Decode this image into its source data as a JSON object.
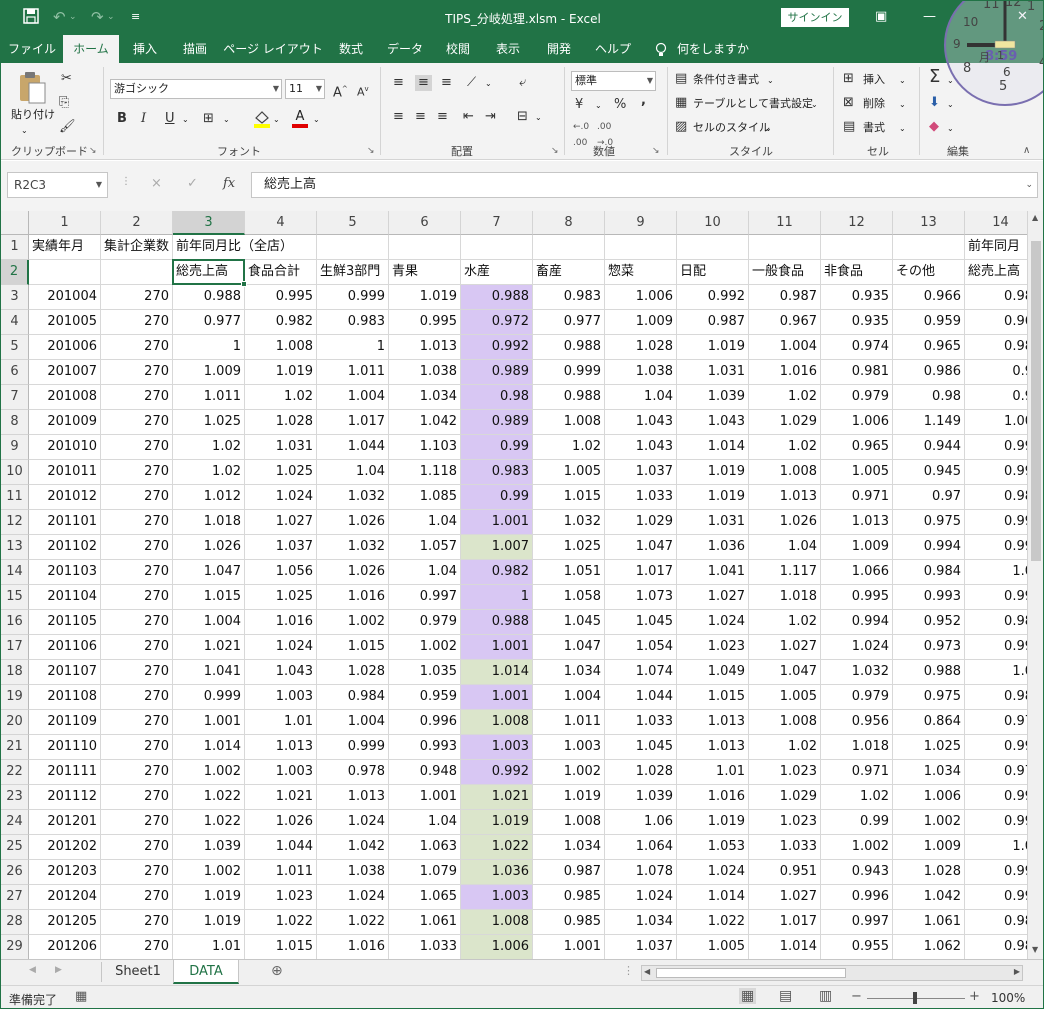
{
  "window": {
    "title": "TIPS_分岐処理.xlsm  -  Excel",
    "signin": "サインイン",
    "save_icon": "save-icon",
    "undo_icon": "undo-icon",
    "redo_icon": "redo-icon"
  },
  "tabs": [
    "ファイル",
    "ホーム",
    "挿入",
    "描画",
    "ページ レイアウト",
    "数式",
    "データ",
    "校閲",
    "表示",
    "開発",
    "ヘルプ",
    "何をしますか"
  ],
  "ribbon": {
    "clipboard": {
      "paste": "貼り付け",
      "label": "クリップボード"
    },
    "font": {
      "name": "游ゴシック",
      "size": "11",
      "label": "フォント",
      "bold": "B",
      "italic": "I",
      "underline": "U",
      "grow": "A",
      "shrink": "A",
      "fontcolor": "A"
    },
    "alignment": {
      "label": "配置"
    },
    "number": {
      "format": "標準",
      "label": "数値",
      "percent": "%",
      "comma": ","
    },
    "styles": {
      "conditional": "条件付き書式",
      "table": "テーブルとして書式設定",
      "cell": "セルのスタイル",
      "label": "スタイル"
    },
    "cells": {
      "insert": "挿入",
      "delete": "削除",
      "format": "書式",
      "label": "セル"
    },
    "editing": {
      "label": "編集",
      "sum": "Σ"
    }
  },
  "formula_bar": {
    "name_box": "R2C3",
    "cancel": "×",
    "enter": "✓",
    "fx": "fx",
    "content": "総売上高"
  },
  "columns": [
    "1",
    "2",
    "3",
    "4",
    "5",
    "6",
    "7",
    "8",
    "9",
    "10",
    "11",
    "12",
    "13",
    "14"
  ],
  "selected": {
    "row": 2,
    "col": 3
  },
  "rows": [
    {
      "n": "1",
      "cells": [
        "実績年月",
        "集計企業数",
        "前年同月比（全店）",
        "",
        "",
        "",
        "",
        "",
        "",
        "",
        "",
        "",
        "",
        "前年同月"
      ]
    },
    {
      "n": "2",
      "cells": [
        "",
        "",
        "総売上高",
        "食品合計",
        "生鮮3部門",
        "青果",
        "水産",
        "畜産",
        "惣菜",
        "日配",
        "一般食品",
        "非食品",
        "その他",
        "総売上高"
      ]
    },
    {
      "n": "3",
      "cells": [
        "201004",
        "270",
        "0.988",
        "0.995",
        "0.999",
        "1.019",
        "0.988",
        "0.983",
        "1.006",
        "0.992",
        "0.987",
        "0.935",
        "0.966",
        "0.98"
      ]
    },
    {
      "n": "4",
      "cells": [
        "201005",
        "270",
        "0.977",
        "0.982",
        "0.983",
        "0.995",
        "0.972",
        "0.977",
        "1.009",
        "0.987",
        "0.967",
        "0.935",
        "0.959",
        "0.96"
      ]
    },
    {
      "n": "5",
      "cells": [
        "201006",
        "270",
        "1",
        "1.008",
        "1",
        "1.013",
        "0.992",
        "0.988",
        "1.028",
        "1.019",
        "1.004",
        "0.974",
        "0.965",
        "0.98"
      ]
    },
    {
      "n": "6",
      "cells": [
        "201007",
        "270",
        "1.009",
        "1.019",
        "1.011",
        "1.038",
        "0.989",
        "0.999",
        "1.038",
        "1.031",
        "1.016",
        "0.981",
        "0.986",
        "0.9"
      ]
    },
    {
      "n": "7",
      "cells": [
        "201008",
        "270",
        "1.011",
        "1.02",
        "1.004",
        "1.034",
        "0.98",
        "0.988",
        "1.04",
        "1.039",
        "1.02",
        "0.979",
        "0.98",
        "0.9"
      ]
    },
    {
      "n": "8",
      "cells": [
        "201009",
        "270",
        "1.025",
        "1.028",
        "1.017",
        "1.042",
        "0.989",
        "1.008",
        "1.043",
        "1.043",
        "1.029",
        "1.006",
        "1.149",
        "1.00"
      ]
    },
    {
      "n": "9",
      "cells": [
        "201010",
        "270",
        "1.02",
        "1.031",
        "1.044",
        "1.103",
        "0.99",
        "1.02",
        "1.043",
        "1.014",
        "1.02",
        "0.965",
        "0.944",
        "0.99"
      ]
    },
    {
      "n": "10",
      "cells": [
        "201011",
        "270",
        "1.02",
        "1.025",
        "1.04",
        "1.118",
        "0.983",
        "1.005",
        "1.037",
        "1.019",
        "1.008",
        "1.005",
        "0.945",
        "0.99"
      ]
    },
    {
      "n": "11",
      "cells": [
        "201012",
        "270",
        "1.012",
        "1.024",
        "1.032",
        "1.085",
        "0.99",
        "1.015",
        "1.033",
        "1.019",
        "1.013",
        "0.971",
        "0.97",
        "0.98"
      ]
    },
    {
      "n": "12",
      "cells": [
        "201101",
        "270",
        "1.018",
        "1.027",
        "1.026",
        "1.04",
        "1.001",
        "1.032",
        "1.029",
        "1.031",
        "1.026",
        "1.013",
        "0.975",
        "0.99"
      ]
    },
    {
      "n": "13",
      "cells": [
        "201102",
        "270",
        "1.026",
        "1.037",
        "1.032",
        "1.057",
        "1.007",
        "1.025",
        "1.047",
        "1.036",
        "1.04",
        "1.009",
        "0.994",
        "0.99"
      ]
    },
    {
      "n": "14",
      "cells": [
        "201103",
        "270",
        "1.047",
        "1.056",
        "1.026",
        "1.04",
        "0.982",
        "1.051",
        "1.017",
        "1.041",
        "1.117",
        "1.066",
        "0.984",
        "1.0"
      ]
    },
    {
      "n": "15",
      "cells": [
        "201104",
        "270",
        "1.015",
        "1.025",
        "1.016",
        "0.997",
        "1",
        "1.058",
        "1.073",
        "1.027",
        "1.018",
        "0.995",
        "0.993",
        "0.99"
      ]
    },
    {
      "n": "16",
      "cells": [
        "201105",
        "270",
        "1.004",
        "1.016",
        "1.002",
        "0.979",
        "0.988",
        "1.045",
        "1.045",
        "1.024",
        "1.02",
        "0.994",
        "0.952",
        "0.98"
      ]
    },
    {
      "n": "17",
      "cells": [
        "201106",
        "270",
        "1.021",
        "1.024",
        "1.015",
        "1.002",
        "1.001",
        "1.047",
        "1.054",
        "1.023",
        "1.027",
        "1.024",
        "0.973",
        "0.99"
      ]
    },
    {
      "n": "18",
      "cells": [
        "201107",
        "270",
        "1.041",
        "1.043",
        "1.028",
        "1.035",
        "1.014",
        "1.034",
        "1.074",
        "1.049",
        "1.047",
        "1.032",
        "0.988",
        "1.0"
      ]
    },
    {
      "n": "19",
      "cells": [
        "201108",
        "270",
        "0.999",
        "1.003",
        "0.984",
        "0.959",
        "1.001",
        "1.004",
        "1.044",
        "1.015",
        "1.005",
        "0.979",
        "0.975",
        "0.98"
      ]
    },
    {
      "n": "20",
      "cells": [
        "201109",
        "270",
        "1.001",
        "1.01",
        "1.004",
        "0.996",
        "1.008",
        "1.011",
        "1.033",
        "1.013",
        "1.008",
        "0.956",
        "0.864",
        "0.97"
      ]
    },
    {
      "n": "21",
      "cells": [
        "201110",
        "270",
        "1.014",
        "1.013",
        "0.999",
        "0.993",
        "1.003",
        "1.003",
        "1.045",
        "1.013",
        "1.02",
        "1.018",
        "1.025",
        "0.99"
      ]
    },
    {
      "n": "22",
      "cells": [
        "201111",
        "270",
        "1.002",
        "1.003",
        "0.978",
        "0.948",
        "0.992",
        "1.002",
        "1.028",
        "1.01",
        "1.023",
        "0.971",
        "1.034",
        "0.97"
      ]
    },
    {
      "n": "23",
      "cells": [
        "201112",
        "270",
        "1.022",
        "1.021",
        "1.013",
        "1.001",
        "1.021",
        "1.019",
        "1.039",
        "1.016",
        "1.029",
        "1.02",
        "1.006",
        "0.99"
      ]
    },
    {
      "n": "24",
      "cells": [
        "201201",
        "270",
        "1.022",
        "1.026",
        "1.024",
        "1.04",
        "1.019",
        "1.008",
        "1.06",
        "1.019",
        "1.023",
        "0.99",
        "1.002",
        "0.99"
      ]
    },
    {
      "n": "25",
      "cells": [
        "201202",
        "270",
        "1.039",
        "1.044",
        "1.042",
        "1.063",
        "1.022",
        "1.034",
        "1.064",
        "1.053",
        "1.033",
        "1.002",
        "1.009",
        "1.0"
      ]
    },
    {
      "n": "26",
      "cells": [
        "201203",
        "270",
        "1.002",
        "1.011",
        "1.038",
        "1.079",
        "1.036",
        "0.987",
        "1.078",
        "1.024",
        "0.951",
        "0.943",
        "1.028",
        "0.99"
      ]
    },
    {
      "n": "27",
      "cells": [
        "201204",
        "270",
        "1.019",
        "1.023",
        "1.024",
        "1.065",
        "1.003",
        "0.985",
        "1.024",
        "1.014",
        "1.027",
        "0.996",
        "1.042",
        "0.99"
      ]
    },
    {
      "n": "28",
      "cells": [
        "201205",
        "270",
        "1.019",
        "1.022",
        "1.022",
        "1.061",
        "1.008",
        "0.985",
        "1.034",
        "1.022",
        "1.017",
        "0.997",
        "1.061",
        "0.98"
      ]
    },
    {
      "n": "29",
      "cells": [
        "201206",
        "270",
        "1.01",
        "1.015",
        "1.016",
        "1.033",
        "1.006",
        "1.001",
        "1.037",
        "1.005",
        "1.014",
        "0.955",
        "1.062",
        "0.98"
      ]
    }
  ],
  "col7_fill": [
    "",
    "",
    "purple",
    "purple",
    "purple",
    "purple",
    "purple",
    "purple",
    "purple",
    "purple",
    "purple",
    "purple",
    "green",
    "purple",
    "purple",
    "purple",
    "purple",
    "green",
    "purple",
    "green",
    "purple",
    "purple",
    "green",
    "green",
    "green",
    "green",
    "purple",
    "green",
    "green"
  ],
  "sheets": [
    "Sheet1",
    "DATA"
  ],
  "active_sheet": "DATA",
  "status": {
    "ready": "準備完了",
    "zoom": "100%"
  },
  "clock": {
    "digital": "8:59",
    "numerals": [
      "11",
      "12",
      "1",
      "2",
      "3",
      "4",
      "5",
      "9",
      "10"
    ],
    "day": "月",
    "date": "1"
  },
  "colors": {
    "accent": "#217346",
    "purple": "#d8c7f3",
    "green": "#dbe5cb"
  }
}
